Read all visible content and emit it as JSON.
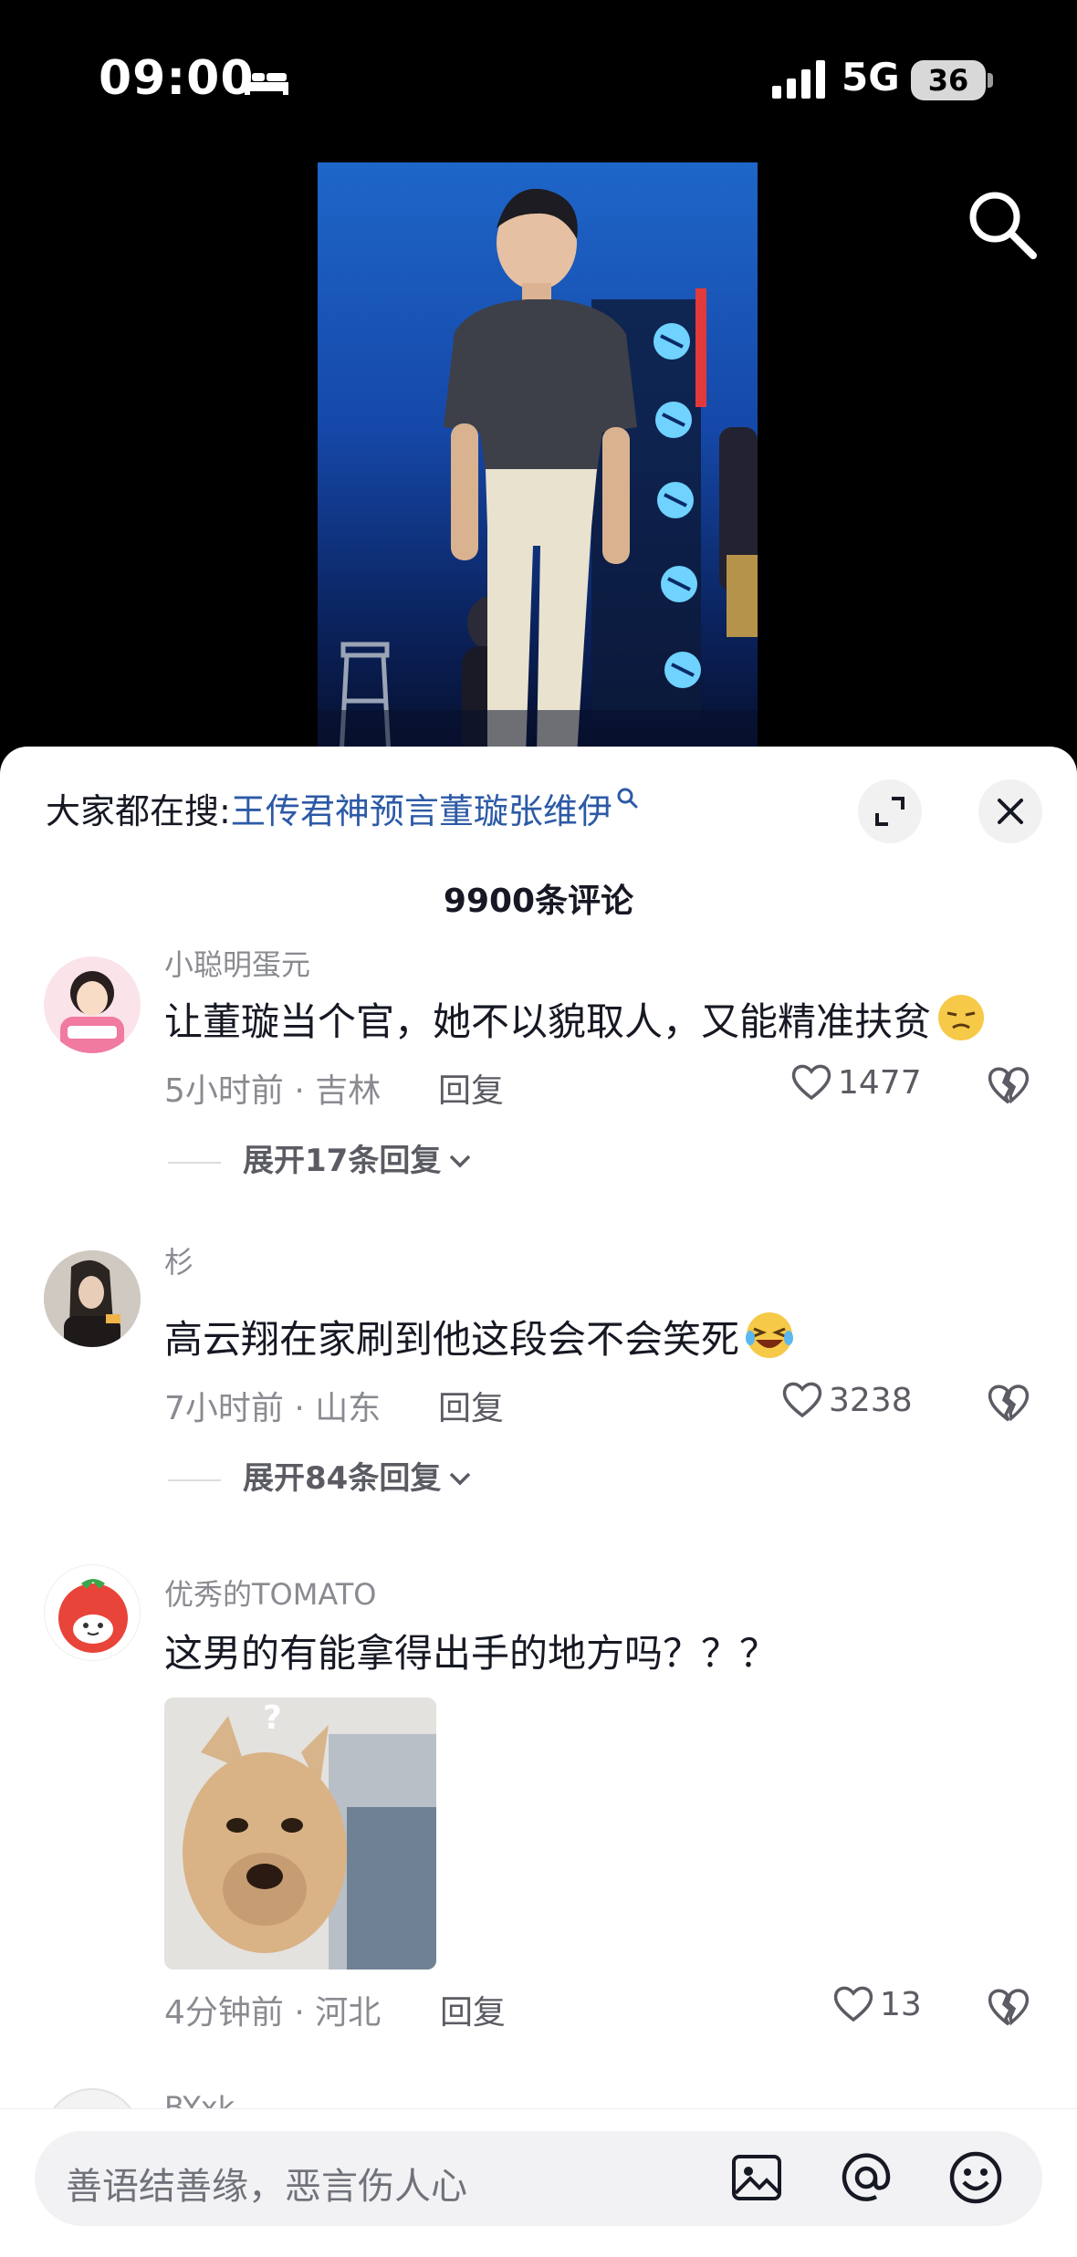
{
  "status_bar": {
    "time": "09:00",
    "network": "5G",
    "battery": "36"
  },
  "colors": {
    "keyword_link": "#2c5aa6",
    "text_primary": "#161823",
    "text_secondary": "#8a8b91"
  },
  "icons": [
    "bed-icon",
    "signal-icon",
    "search-icon",
    "expand-icon",
    "close-icon",
    "heart-icon",
    "broken-heart-icon",
    "chevron-down-icon",
    "image-icon",
    "at-icon",
    "emoji-icon"
  ],
  "sheet": {
    "suggest_prefix": "大家都在搜:",
    "suggest_keyword": "王传君神预言董璇张维伊",
    "comment_count": "9900条评论"
  },
  "comments": [
    {
      "username": "小聪明蛋元",
      "text": "让董璇当个官，她不以貌取人，又能精准扶贫",
      "time_location": "5小时前 · 吉林",
      "reply_label": "回复",
      "likes": "1477",
      "expand_label": "展开17条回复"
    },
    {
      "username": "杉",
      "text": "高云翔在家刷到他这段会不会笑死",
      "time_location": "7小时前 · 山东",
      "reply_label": "回复",
      "likes": "3238",
      "expand_label": "展开84条回复"
    },
    {
      "username": "优秀的TOMATO",
      "text": "这男的有能拿得出手的地方吗？？？",
      "time_location": "4分钟前 · 河北",
      "reply_label": "回复",
      "likes": "13"
    },
    {
      "username": "BYxk"
    }
  ],
  "input_bar": {
    "placeholder": "善语结善缘，恶言伤人心"
  }
}
